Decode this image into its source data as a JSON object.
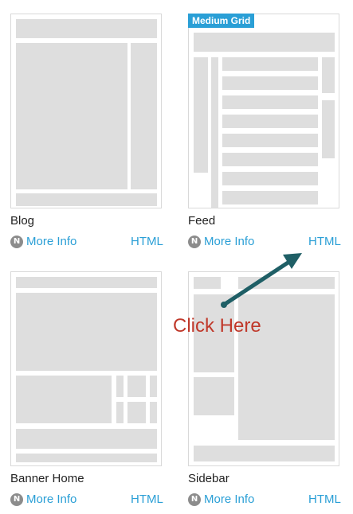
{
  "cards": [
    {
      "title": "Blog",
      "more_info": "More Info",
      "html": "HTML"
    },
    {
      "title": "Feed",
      "more_info": "More Info",
      "html": "HTML",
      "badge": "Medium Grid"
    },
    {
      "title": "Banner Home",
      "more_info": "More Info",
      "html": "HTML"
    },
    {
      "title": "Sidebar",
      "more_info": "More Info",
      "html": "HTML"
    }
  ],
  "info_icon_letter": "N",
  "callout": "Click Here",
  "colors": {
    "link": "#2a9fd6",
    "badge_bg": "#2a9fd6",
    "placeholder": "#dedede",
    "callout_text": "#c0392b",
    "arrow": "#1f5f66"
  }
}
